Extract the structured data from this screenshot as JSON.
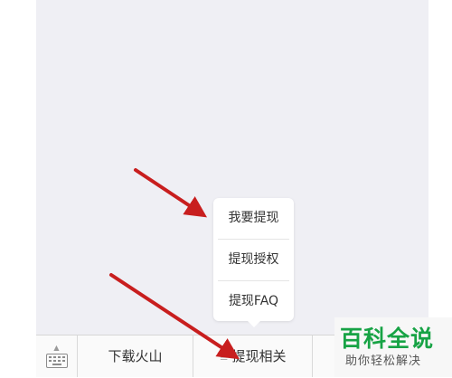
{
  "popup": {
    "items": [
      {
        "label": "我要提现"
      },
      {
        "label": "提现授权"
      },
      {
        "label": "提现FAQ"
      }
    ]
  },
  "bottom_bar": {
    "keyboard_icon": "keyboard-icon",
    "menus": [
      {
        "label": "下载火山"
      },
      {
        "label": "提现相关"
      },
      {
        "label": ""
      }
    ]
  },
  "annotation": {
    "arrow_color": "#c81e1e"
  },
  "watermark": {
    "logo": "百科全说",
    "tagline": "助你轻松解决",
    "logo_color": "#17a345"
  }
}
